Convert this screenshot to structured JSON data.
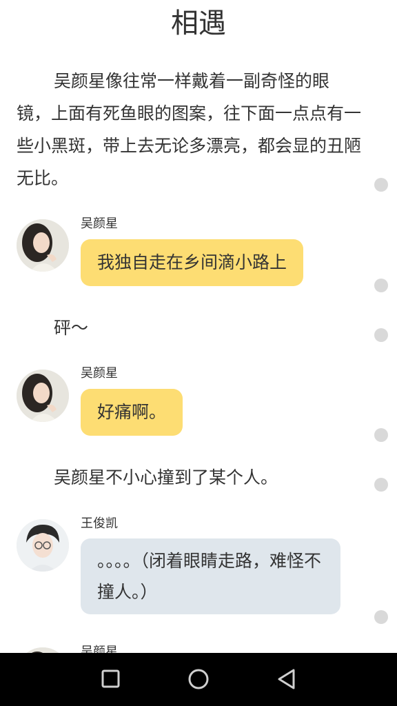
{
  "title": "相遇",
  "narration_1": "吴颜星像往常一样戴着一副奇怪的眼镜，上面有死鱼眼的图案，往下面一点点有一些小黑斑，带上去无论多漂亮，都会显的丑陋无比。",
  "messages": [
    {
      "name": "吴颜星",
      "text": "我独自走在乡间滴小路上"
    },
    {
      "name": "吴颜星",
      "text": "好痛啊。"
    },
    {
      "name": "王俊凯",
      "text": "。。。。（闭着眼睛走路，难怪不撞人。）"
    },
    {
      "name": "吴颜星"
    }
  ],
  "narration_2": "砰～",
  "narration_3": "吴颜星不小心撞到了某个人。",
  "icons": {
    "recent": "square-icon",
    "home": "circle-icon",
    "back": "triangle-back-icon"
  },
  "colors": {
    "bubble_yellow": "#fddd73",
    "bubble_blue": "#dfe6ec",
    "dot": "#d9d9d9",
    "navbar": "#000000"
  }
}
